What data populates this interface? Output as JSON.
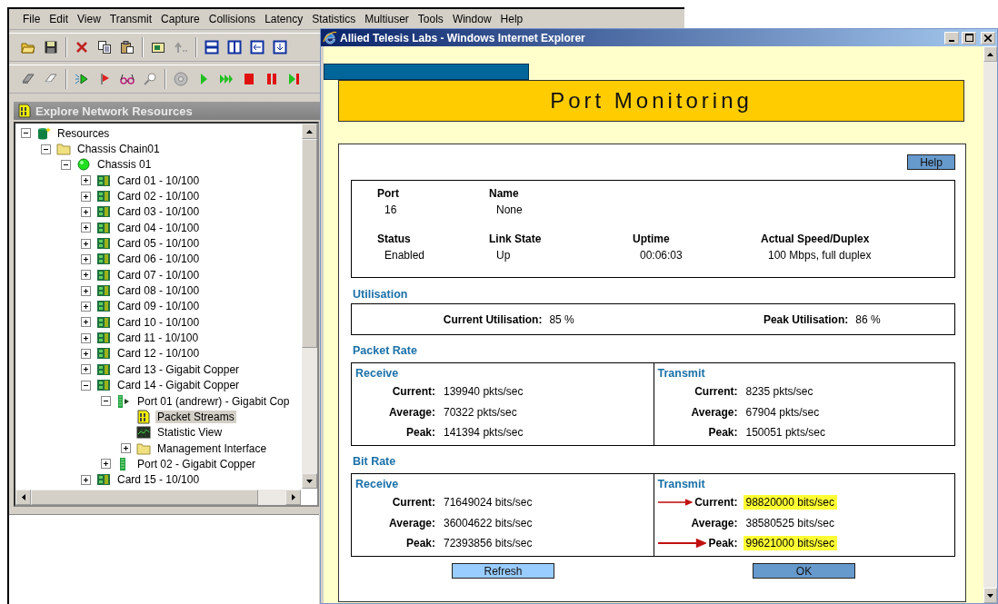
{
  "app": {
    "menu": [
      "File",
      "Edit",
      "View",
      "Transmit",
      "Capture",
      "Collisions",
      "Latency",
      "Statistics",
      "Multiuser",
      "Tools",
      "Window",
      "Help"
    ],
    "panel_title": "Explore Network Resources",
    "tree": [
      {
        "label": "Resources",
        "kind": "database",
        "expanded": true,
        "selected": false,
        "children": [
          {
            "label": "Chassis Chain01",
            "kind": "folder",
            "expanded": true,
            "selected": false,
            "children": [
              {
                "label": "Chassis 01",
                "kind": "chassis",
                "expanded": true,
                "selected": false,
                "children": [
                  {
                    "label": "Card 01 - 10/100",
                    "kind": "card",
                    "expanded": false,
                    "selected": false
                  },
                  {
                    "label": "Card 02 - 10/100",
                    "kind": "card",
                    "expanded": false,
                    "selected": false
                  },
                  {
                    "label": "Card 03 - 10/100",
                    "kind": "card",
                    "expanded": false,
                    "selected": false
                  },
                  {
                    "label": "Card 04 - 10/100",
                    "kind": "card",
                    "expanded": false,
                    "selected": false
                  },
                  {
                    "label": "Card 05 - 10/100",
                    "kind": "card",
                    "expanded": false,
                    "selected": false
                  },
                  {
                    "label": "Card 06 - 10/100",
                    "kind": "card",
                    "expanded": false,
                    "selected": false
                  },
                  {
                    "label": "Card 07 - 10/100",
                    "kind": "card",
                    "expanded": false,
                    "selected": false
                  },
                  {
                    "label": "Card 08 - 10/100",
                    "kind": "card",
                    "expanded": false,
                    "selected": false
                  },
                  {
                    "label": "Card 09 - 10/100",
                    "kind": "card",
                    "expanded": false,
                    "selected": false
                  },
                  {
                    "label": "Card 10 - 10/100",
                    "kind": "card",
                    "expanded": false,
                    "selected": false
                  },
                  {
                    "label": "Card 11 - 10/100",
                    "kind": "card",
                    "expanded": false,
                    "selected": false
                  },
                  {
                    "label": "Card 12 - 10/100",
                    "kind": "card",
                    "expanded": false,
                    "selected": false
                  },
                  {
                    "label": "Card 13 - Gigabit Copper",
                    "kind": "card",
                    "expanded": false,
                    "selected": false
                  },
                  {
                    "label": "Card 14 - Gigabit Copper",
                    "kind": "card",
                    "expanded": true,
                    "selected": false,
                    "children": [
                      {
                        "label": "Port 01  (andrewr)  - Gigabit Cop",
                        "kind": "port-active",
                        "expanded": true,
                        "selected": false,
                        "children": [
                          {
                            "label": "Packet Streams",
                            "kind": "streams",
                            "selected": true
                          },
                          {
                            "label": "Statistic View",
                            "kind": "stats",
                            "selected": false
                          },
                          {
                            "label": "Management Interface",
                            "kind": "folder",
                            "expanded": false,
                            "selected": false
                          }
                        ]
                      },
                      {
                        "label": "Port 02  - Gigabit Copper",
                        "kind": "port",
                        "expanded": false,
                        "selected": false
                      }
                    ]
                  },
                  {
                    "label": "Card 15 - 10/100",
                    "kind": "card",
                    "expanded": false,
                    "selected": false
                  }
                ]
              }
            ]
          }
        ]
      }
    ]
  },
  "browser": {
    "title": "Allied Telesis Labs - Windows Internet Explorer",
    "page": {
      "banner": "Port Monitoring",
      "help_button": "Help",
      "info_rows": [
        [
          {
            "label": "Port",
            "value": "16"
          },
          {
            "label": "Name",
            "value": "None"
          }
        ],
        [
          {
            "label": "Status",
            "value": "Enabled"
          },
          {
            "label": "Link State",
            "value": "Up"
          },
          {
            "label": "Uptime",
            "value": "00:06:03"
          },
          {
            "label": "Actual Speed/Duplex",
            "value": "100 Mbps, full duplex"
          }
        ]
      ],
      "utilisation": {
        "heading": "Utilisation",
        "items": [
          {
            "label": "Current Utilisation:",
            "value": "85 %"
          },
          {
            "label": "Peak Utilisation:",
            "value": "86 %"
          }
        ]
      },
      "rate_sections": [
        {
          "heading": "Packet Rate",
          "columns": [
            {
              "title": "Receive",
              "rows": [
                {
                  "label": "Current:",
                  "value": "139940 pkts/sec",
                  "highlighted": false
                },
                {
                  "label": "Average:",
                  "value": "70322 pkts/sec",
                  "highlighted": false
                },
                {
                  "label": "Peak:",
                  "value": "141394 pkts/sec",
                  "highlighted": false
                }
              ]
            },
            {
              "title": "Transmit",
              "rows": [
                {
                  "label": "Current:",
                  "value": "8235 pkts/sec",
                  "highlighted": false
                },
                {
                  "label": "Average:",
                  "value": "67904 pkts/sec",
                  "highlighted": false
                },
                {
                  "label": "Peak:",
                  "value": "150051 pkts/sec",
                  "highlighted": false
                }
              ]
            }
          ]
        },
        {
          "heading": "Bit Rate",
          "columns": [
            {
              "title": "Receive",
              "rows": [
                {
                  "label": "Current:",
                  "value": "71649024 bits/sec",
                  "highlighted": false
                },
                {
                  "label": "Average:",
                  "value": "36004622 bits/sec",
                  "highlighted": false
                },
                {
                  "label": "Peak:",
                  "value": "72393856 bits/sec",
                  "highlighted": false
                }
              ]
            },
            {
              "title": "Transmit",
              "rows": [
                {
                  "label": "Current:",
                  "value": "98820000 bits/sec",
                  "highlighted": true
                },
                {
                  "label": "Average:",
                  "value": "38580525 bits/sec",
                  "highlighted": false
                },
                {
                  "label": "Peak:",
                  "value": "99621000 bits/sec",
                  "highlighted": true
                }
              ]
            }
          ]
        }
      ],
      "buttons": [
        {
          "label": "Refresh",
          "kind": "secondary"
        },
        {
          "label": "OK",
          "kind": "primary"
        }
      ]
    }
  }
}
